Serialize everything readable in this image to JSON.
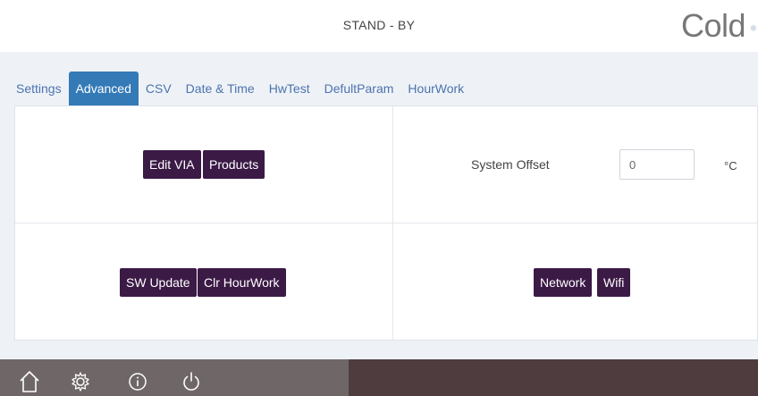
{
  "header": {
    "status": "STAND - BY",
    "mode": "Cold",
    "mode_icon": "snowflake-icon"
  },
  "tabs": [
    {
      "label": "Settings",
      "active": false
    },
    {
      "label": "Advanced",
      "active": true
    },
    {
      "label": "CSV",
      "active": false
    },
    {
      "label": "Date & Time",
      "active": false
    },
    {
      "label": "HwTest",
      "active": false
    },
    {
      "label": "DefultParam",
      "active": false
    },
    {
      "label": "HourWork",
      "active": false
    }
  ],
  "advanced": {
    "edit_via": "Edit VIA",
    "products": "Products",
    "sw_update": "SW Update",
    "clr_hourwork": "Clr HourWork",
    "network": "Network",
    "wifi": "Wifi",
    "system_offset_label": "System Offset",
    "system_offset_value": "0",
    "system_offset_unit": "°C"
  },
  "footer": {
    "icons": [
      "home-icon",
      "settings-icon",
      "info-icon",
      "power-icon"
    ]
  },
  "colors": {
    "accent": "#337ab7",
    "button": "#3b1a46",
    "footer_left": "#6f6767",
    "footer_right": "#4e3c3e",
    "panel": "#eef2f7"
  }
}
